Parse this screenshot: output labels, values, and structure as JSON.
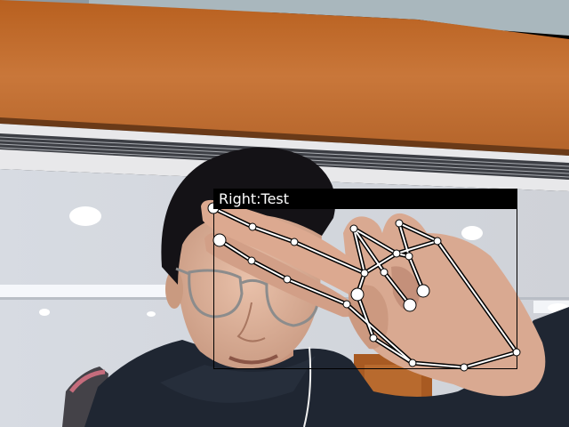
{
  "detection": {
    "label": "Right:Test",
    "box_color": "#000000",
    "skeleton_color": "#ffffff",
    "keypoint_color": "#ffffff"
  },
  "scene": {
    "ceiling_color": "#c06a2a",
    "wall_color": "#dcdde0",
    "hoodie_color": "#1f2632"
  }
}
